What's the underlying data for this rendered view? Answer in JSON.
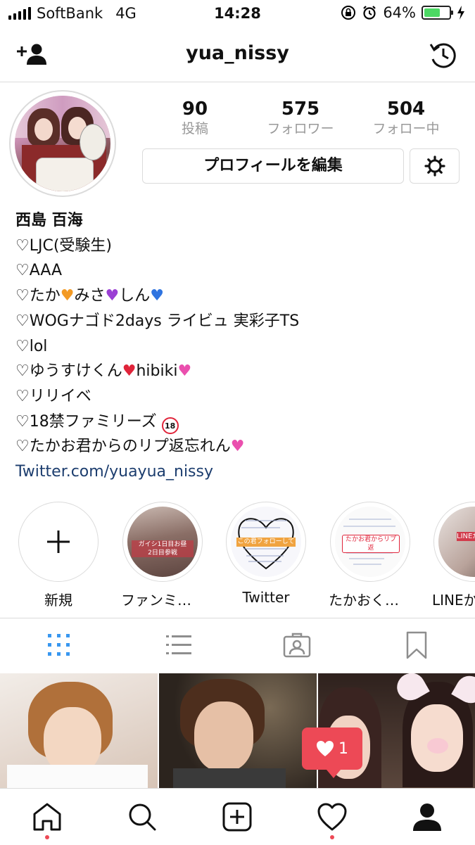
{
  "status_bar": {
    "carrier": "SoftBank",
    "network": "4G",
    "time": "14:28",
    "battery": "64%",
    "battery_level": 0.64
  },
  "nav": {
    "username": "yua_nissy",
    "left_icon": "add-user-icon",
    "right_icon": "history-icon"
  },
  "profile": {
    "stats": [
      {
        "value": "90",
        "label": "投稿"
      },
      {
        "value": "575",
        "label": "フォロワー"
      },
      {
        "value": "504",
        "label": "フォロー中"
      }
    ],
    "edit_button": "プロフィールを編集",
    "name": "西島 百海",
    "bio": {
      "l1": "♡LJC(受験生)",
      "l2": "♡AAA",
      "l3a": "♡たか",
      "l3b": "みさ",
      "l3c": "しん",
      "l4": "♡WOGナゴド2days ライビュ 実彩子TS",
      "l5": "♡lol",
      "l6a": "♡ゆうすけくん",
      "l6b": "hibiki",
      "l7": "♡リリイベ",
      "l8": "♡18禁ファミリーズ",
      "l8_badge": "18",
      "l9": "♡たかお君からのリプ返忘れん"
    },
    "link": "Twitter.com/yuayua_nissy"
  },
  "highlights": [
    {
      "caption": "新規"
    },
    {
      "caption": "ファンミ当選",
      "overlay": "ガイシ1日目お昼\n2日目参戦"
    },
    {
      "caption": "Twitter",
      "overlay": "この君フォローして"
    },
    {
      "caption": "たかおくんリ…",
      "overlay": "たかお君からリプ返"
    },
    {
      "caption": "LINEか",
      "overlay": "LINEか 送ってくだ"
    }
  ],
  "activity": {
    "like_count": "1"
  },
  "colors": {
    "accent": "#3897f0",
    "notification": "#ed4956",
    "link": "#1c3d6e",
    "muted": "#999999",
    "border": "#dbdbdb"
  }
}
